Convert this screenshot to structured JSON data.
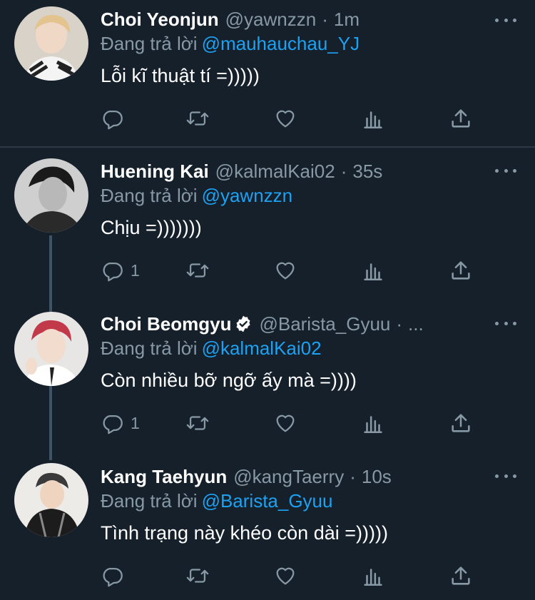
{
  "tweets": [
    {
      "name": "Choi Yeonjun",
      "handle": "@yawnzzn",
      "dot": "·",
      "time": "1m",
      "replying_label": "Đang trả lời",
      "replying_to": "@mauhauchau_YJ",
      "text": "Lỗi kĩ thuật tí =)))))",
      "reply_count": "",
      "verified": false
    },
    {
      "name": "Huening Kai",
      "handle": "@kalmalKai02",
      "dot": "·",
      "time": "35s",
      "replying_label": "Đang trả lời",
      "replying_to": "@yawnzzn",
      "text": "Chịu =)))))))",
      "reply_count": "1",
      "verified": false
    },
    {
      "name": "Choi Beomgyu",
      "handle": "@Barista_Gyuu",
      "dot": "·",
      "time": "...",
      "replying_label": "Đang trả lời",
      "replying_to": "@kalmalKai02",
      "text": "Còn nhiều bỡ ngỡ ấy mà =))))",
      "reply_count": "1",
      "verified": true
    },
    {
      "name": "Kang Taehyun",
      "handle": "@kangTaerry",
      "dot": "·",
      "time": "10s",
      "replying_label": "Đang trả lời",
      "replying_to": "@Barista_Gyuu",
      "text": "Tình trạng này khéo còn dài =)))))",
      "reply_count": "",
      "verified": false
    }
  ],
  "colors": {
    "background": "#15202b",
    "primary_text": "#ffffff",
    "secondary_text": "#8899a6",
    "accent": "#1da1f2"
  },
  "icons": {
    "reply": "reply-icon",
    "retweet": "retweet-icon",
    "like": "heart-icon",
    "analytics": "analytics-icon",
    "share": "share-icon",
    "more": "more-icon",
    "verified": "verified-badge-icon"
  }
}
